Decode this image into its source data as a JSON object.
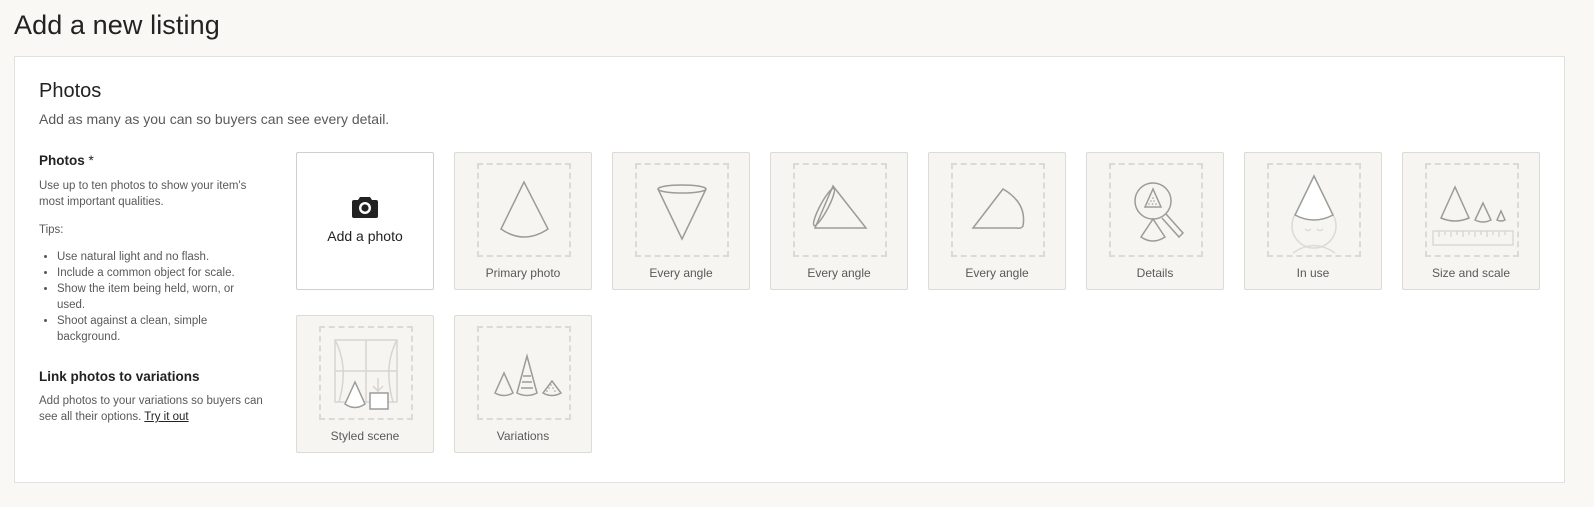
{
  "page": {
    "title": "Add a new listing"
  },
  "photos_section": {
    "title": "Photos",
    "subtitle": "Add as many as you can so buyers can see every detail."
  },
  "sidebar": {
    "heading": "Photos",
    "required_marker": "*",
    "description": "Use up to ten photos to show your item's most important qualities.",
    "tips_label": "Tips:",
    "tips": [
      "Use natural light and no flash.",
      "Include a common object for scale.",
      "Show the item being held, worn, or used.",
      "Shoot against a clean, simple background."
    ],
    "link_heading": "Link photos to variations",
    "link_description": "Add photos to your variations so buyers can see all their options.",
    "link_text": "Try it out"
  },
  "tiles": {
    "add": {
      "label": "Add a photo",
      "icon": "camera-icon"
    },
    "slots": [
      {
        "label": "Primary photo",
        "icon": "cone-icon"
      },
      {
        "label": "Every angle",
        "icon": "cone-inverted-icon"
      },
      {
        "label": "Every angle",
        "icon": "cone-side-icon"
      },
      {
        "label": "Every angle",
        "icon": "cone-tilted-icon"
      },
      {
        "label": "Details",
        "icon": "magnifier-icon"
      },
      {
        "label": "In use",
        "icon": "cone-hat-face-icon"
      },
      {
        "label": "Size and scale",
        "icon": "ruler-cones-icon"
      },
      {
        "label": "Styled scene",
        "icon": "window-scene-icon"
      },
      {
        "label": "Variations",
        "icon": "cone-variations-icon"
      }
    ]
  },
  "colors": {
    "illustration_stroke": "#9b9b98",
    "dashed_frame": "#dbdad6",
    "tile_bg": "#f6f5f1"
  }
}
